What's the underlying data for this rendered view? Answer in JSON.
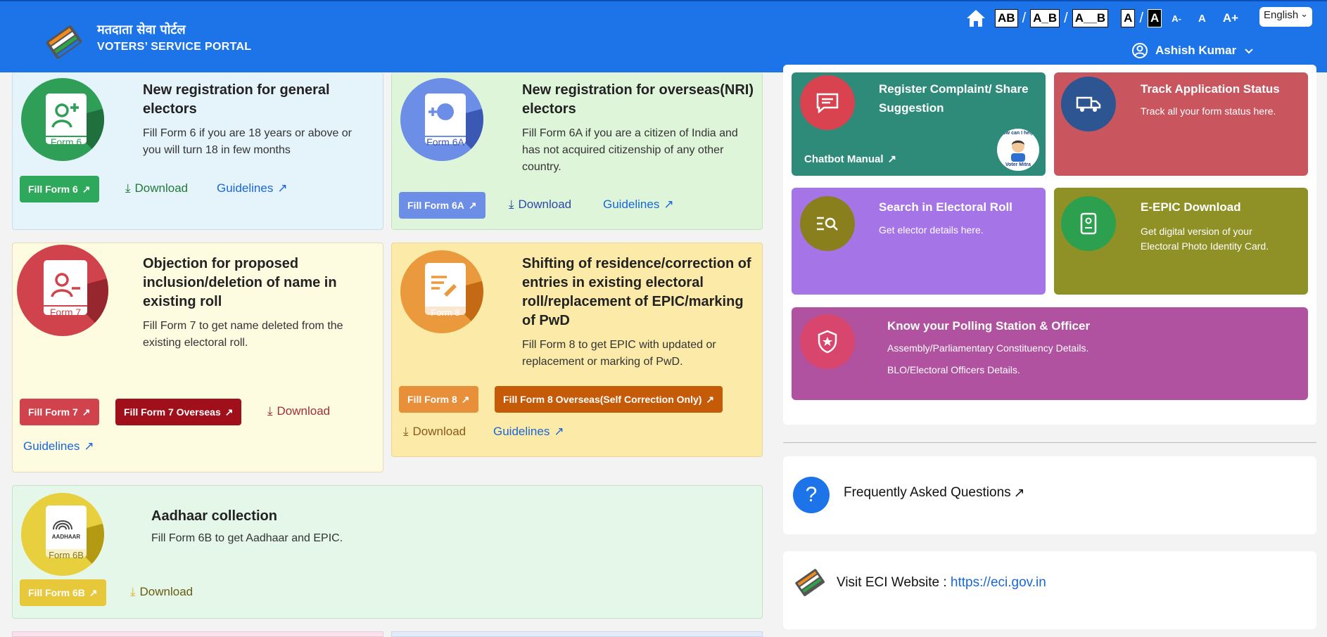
{
  "header": {
    "title_hindi": "मतदाता सेवा पोर्टल",
    "title_en": "VOTERS’ SERVICE PORTAL",
    "font_tools": [
      "AB",
      "A_B",
      "A__B",
      "A",
      "A",
      "A-",
      "A",
      "A+"
    ],
    "language": "English",
    "user_name": "Ashish Kumar"
  },
  "forms": [
    {
      "badge": "Form 6",
      "title": "New registration for general electors",
      "desc": "Fill Form 6 if you are 18 years or above or you will turn 18 in few months",
      "btn": "Fill Form 6",
      "download": "Download",
      "guidelines": "Guidelines"
    },
    {
      "badge": "Form 6A",
      "title": "New registration for overseas(NRI) electors",
      "desc": "Fill Form 6A if you are a citizen of India and has not acquired citizenship of any other country.",
      "btn": "Fill Form 6A",
      "download": "Download",
      "guidelines": "Guidelines"
    },
    {
      "badge": "Form 7",
      "title": "Objection for proposed inclusion/deletion of name in existing roll",
      "desc": "Fill Form 7 to get name deleted from the existing electoral roll.",
      "btn": "Fill Form 7",
      "btn2": "Fill Form 7 Overseas",
      "download": "Download",
      "guidelines": "Guidelines"
    },
    {
      "badge": "Form 8",
      "title": "Shifting of residence/correction of entries in existing electoral roll/replacement of EPIC/marking of PwD",
      "desc": "Fill Form 8 to get EPIC with updated or replacement or marking of PwD.",
      "btn": "Fill Form 8",
      "btn2": "Fill Form 8 Overseas(Self Correction Only)",
      "download": "Download",
      "guidelines": "Guidelines"
    },
    {
      "badge": "Form 6B",
      "aadhaar": "AADHAAR",
      "title": "Aadhaar collection",
      "desc": "Fill Form 6B to get Aadhaar and EPIC.",
      "btn": "Fill Form 6B",
      "download": "Download"
    }
  ],
  "services": [
    {
      "title": "Register Complaint/ Share Suggestion",
      "link": "Chatbot Manual",
      "mitra_top": "How can I help?",
      "mitra_bottom": "Voter Mitra",
      "color": "#2e8b7a"
    },
    {
      "title": "Track Application Status",
      "desc": "Track all your form status here.",
      "color": "#c9565e"
    },
    {
      "title": "Search in Electoral Roll",
      "desc": "Get elector details here.",
      "color": "#a574e6"
    },
    {
      "title": "E-EPIC Download",
      "desc": "Get digital version of your Electoral Photo Identity Card.",
      "color": "#8f9127"
    },
    {
      "title": "Know your Polling Station & Officer",
      "desc1": "Assembly/Parliamentary Constituency Details.",
      "desc2": "BLO/Electoral Officers Details.",
      "color": "#b0529f"
    }
  ],
  "faq": {
    "icon": "?",
    "label": "Frequently Asked Questions"
  },
  "eci": {
    "label": "Visit ECI Website :",
    "url": "https://eci.gov.in"
  }
}
